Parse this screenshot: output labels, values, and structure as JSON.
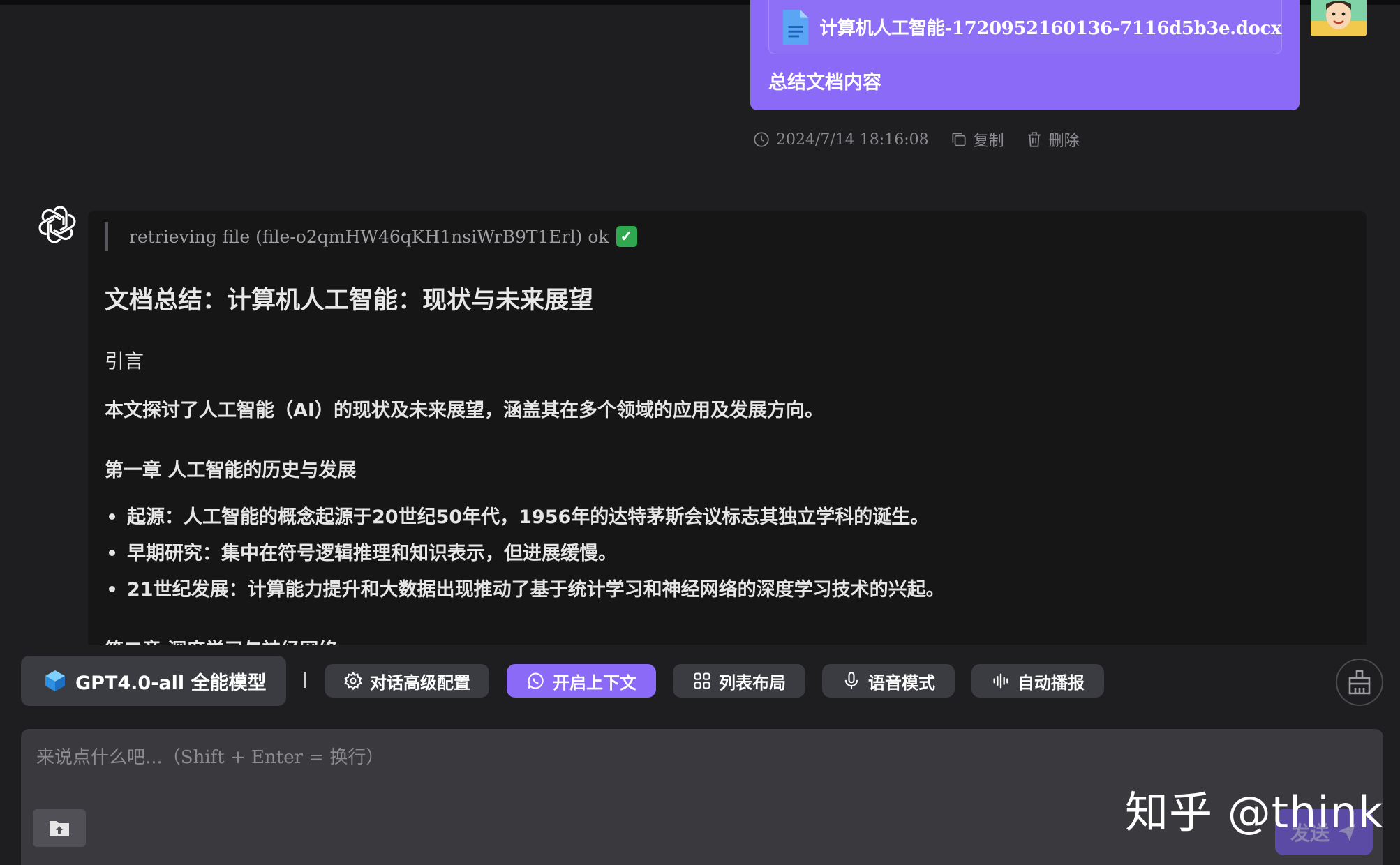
{
  "user_message": {
    "file_name": "计算机人工智能-1720952160136-7116d5b3e.docx",
    "text": "总结文档内容",
    "timestamp": "2024/7/14 18:16:08",
    "copy_label": "复制",
    "delete_label": "删除",
    "bubble_color": "#8a6af6"
  },
  "assistant_message": {
    "retrieval_note": "retrieving file (file-o2qmHW46qKH1nsiWrB9T1Erl) ok",
    "title": "文档总结：计算机人工智能：现状与未来展望",
    "intro_heading": "引言",
    "intro_text": "本文探讨了人工智能（AI）的现状及未来展望，涵盖其在多个领域的应用及发展方向。",
    "chapter1_heading": "第一章 人工智能的历史与发展",
    "chapter1_items": [
      "起源：人工智能的概念起源于20世纪50年代，1956年的达特茅斯会议标志其独立学科的诞生。",
      "早期研究：集中在符号逻辑推理和知识表示，但进展缓慢。",
      "21世纪发展：计算能力提升和大数据出现推动了基于统计学习和神经网络的深度学习技术的兴起。"
    ],
    "chapter2_heading_partial": "第二章 深度学习与神经网络"
  },
  "toolbar": {
    "model_label": "GPT4.0-all 全能模型",
    "advanced_config": "对话高级配置",
    "context_toggle": "开启上下文",
    "list_layout": "列表布局",
    "voice_mode": "语音模式",
    "auto_broadcast": "自动播报",
    "active_color": "#8a6af6"
  },
  "input": {
    "placeholder": "来说点什么吧...（Shift + Enter = 换行）",
    "send_label": "发送"
  },
  "watermark": "知乎 @think"
}
